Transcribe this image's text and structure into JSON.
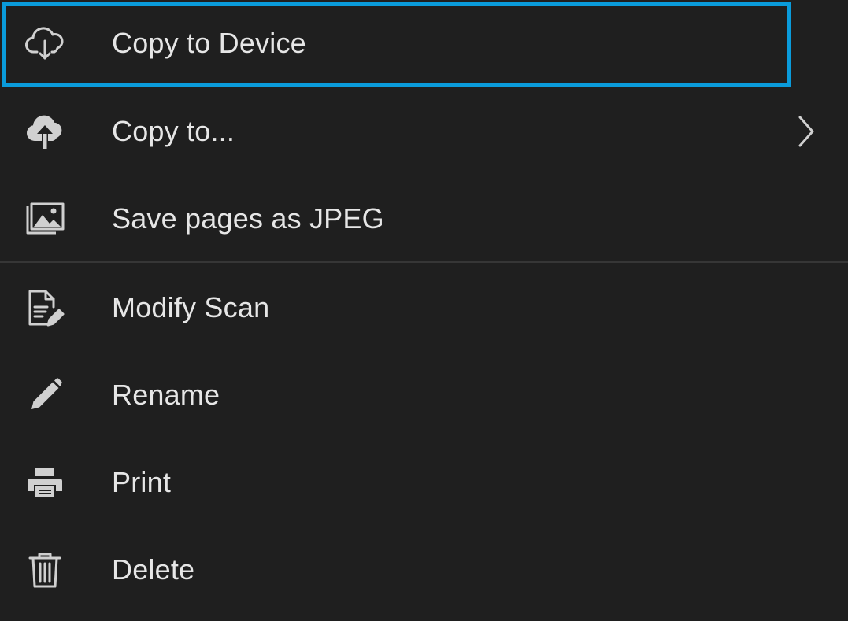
{
  "menu": {
    "items": [
      {
        "label": "Copy to Device",
        "icon": "cloud-download-icon",
        "selected": true
      },
      {
        "label": "Copy to...",
        "icon": "cloud-upload-icon",
        "submenu": true
      },
      {
        "label": "Save pages as JPEG",
        "icon": "images-icon"
      },
      {
        "label": "Modify Scan",
        "icon": "document-edit-icon"
      },
      {
        "label": "Rename",
        "icon": "pencil-icon"
      },
      {
        "label": "Print",
        "icon": "printer-icon"
      },
      {
        "label": "Delete",
        "icon": "trash-icon"
      }
    ]
  },
  "colors": {
    "background": "#1f1f1f",
    "text": "#e6e6e6",
    "icon": "#d0d0d0",
    "focus": "#0a9bdb",
    "divider": "#363636"
  }
}
